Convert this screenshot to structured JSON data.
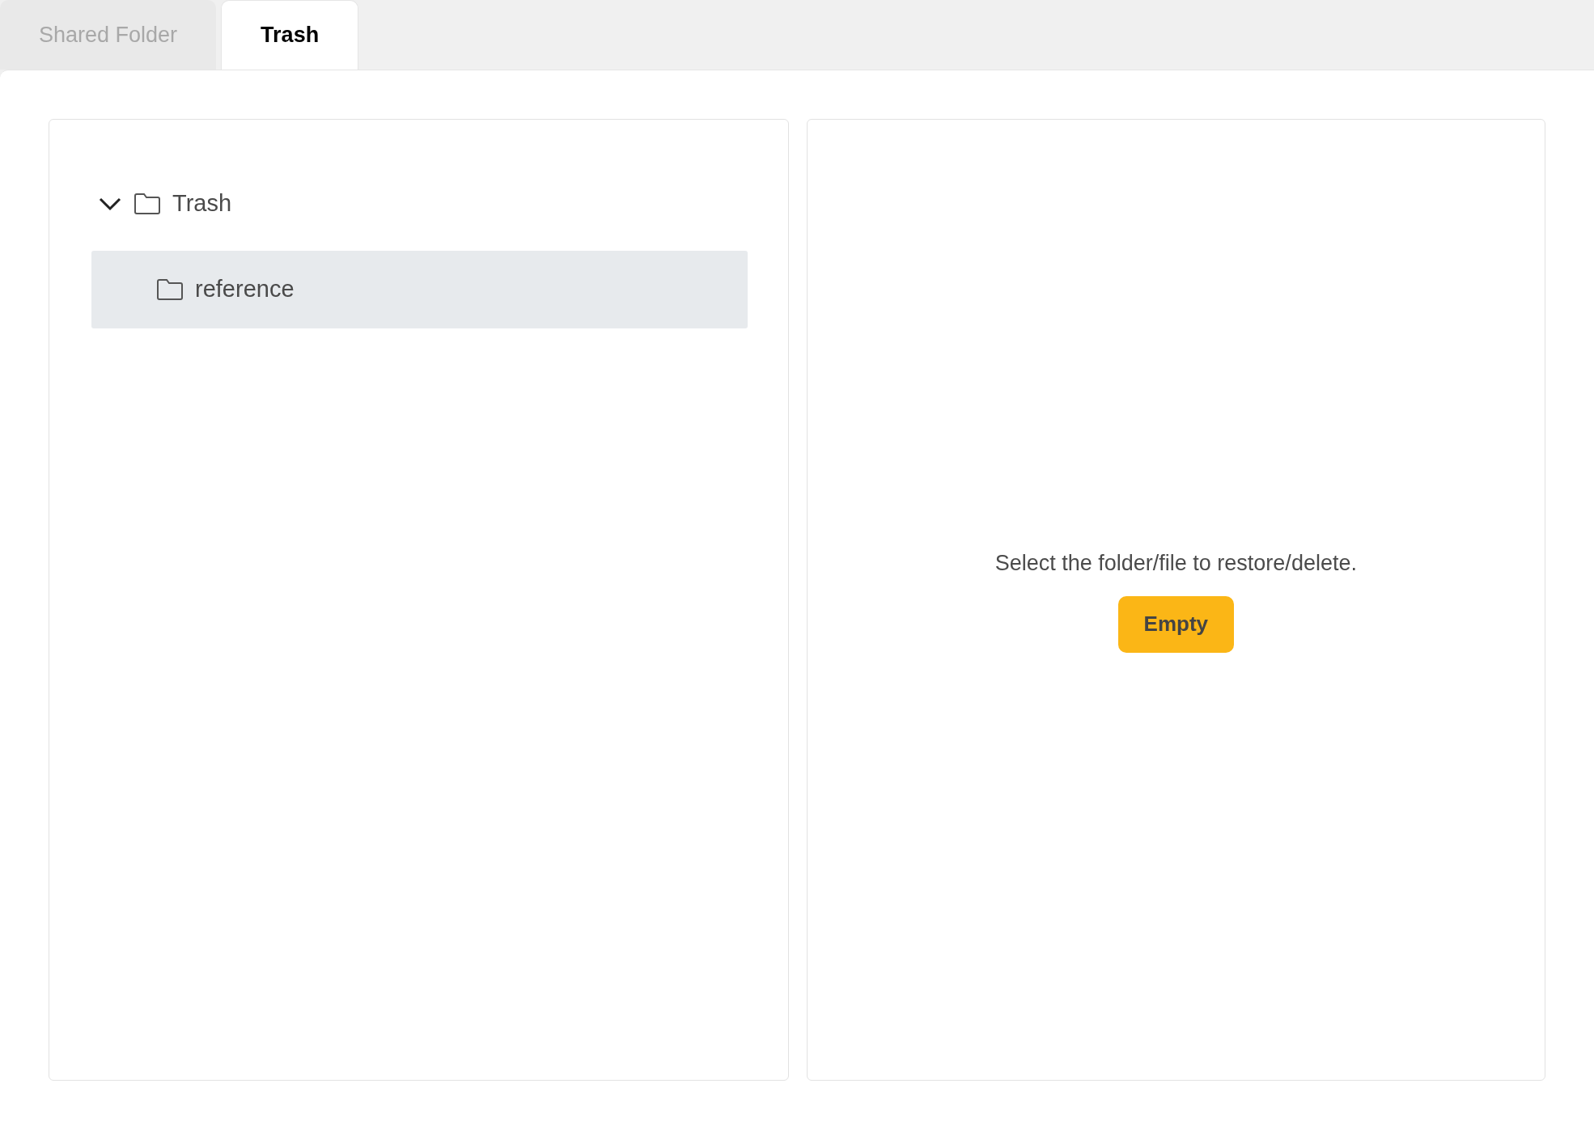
{
  "tabs": [
    {
      "label": "Shared Folder",
      "selected": false
    },
    {
      "label": "Trash",
      "selected": true
    }
  ],
  "tree": [
    {
      "label": "Trash",
      "expanded": true,
      "selected": false,
      "children": [
        {
          "label": "reference",
          "selected": true
        }
      ]
    }
  ],
  "detail": {
    "message": "Select the folder/file to restore/delete.",
    "button": "Empty"
  }
}
